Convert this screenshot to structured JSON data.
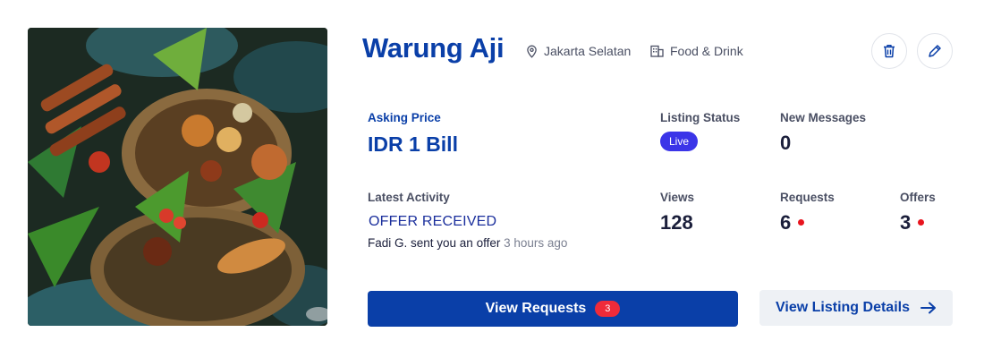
{
  "listing": {
    "title": "Warung Aji",
    "location": "Jakarta Selatan",
    "category": "Food & Drink",
    "image_icon": "food-photo"
  },
  "actions": {
    "delete_icon": "trash-icon",
    "edit_icon": "pencil-icon"
  },
  "stats": {
    "asking_price_label": "Asking Price",
    "asking_price_value": "IDR 1 Bill",
    "listing_status_label": "Listing Status",
    "listing_status_value": "Live",
    "new_messages_label": "New Messages",
    "new_messages_value": "0",
    "views_label": "Views",
    "views_value": "128",
    "requests_label": "Requests",
    "requests_value": "6",
    "offers_label": "Offers",
    "offers_value": "3"
  },
  "activity": {
    "label": "Latest Activity",
    "type": "OFFER RECEIVED",
    "detail": "Fadi G. sent you an offer",
    "time_ago": "3 hours ago"
  },
  "buttons": {
    "view_requests_label": "View Requests",
    "view_requests_count": "3",
    "view_details_label": "View Listing Details"
  },
  "colors": {
    "brand": "#0a3fa8",
    "status_live": "#3b35e8",
    "alert": "#e8141e"
  }
}
